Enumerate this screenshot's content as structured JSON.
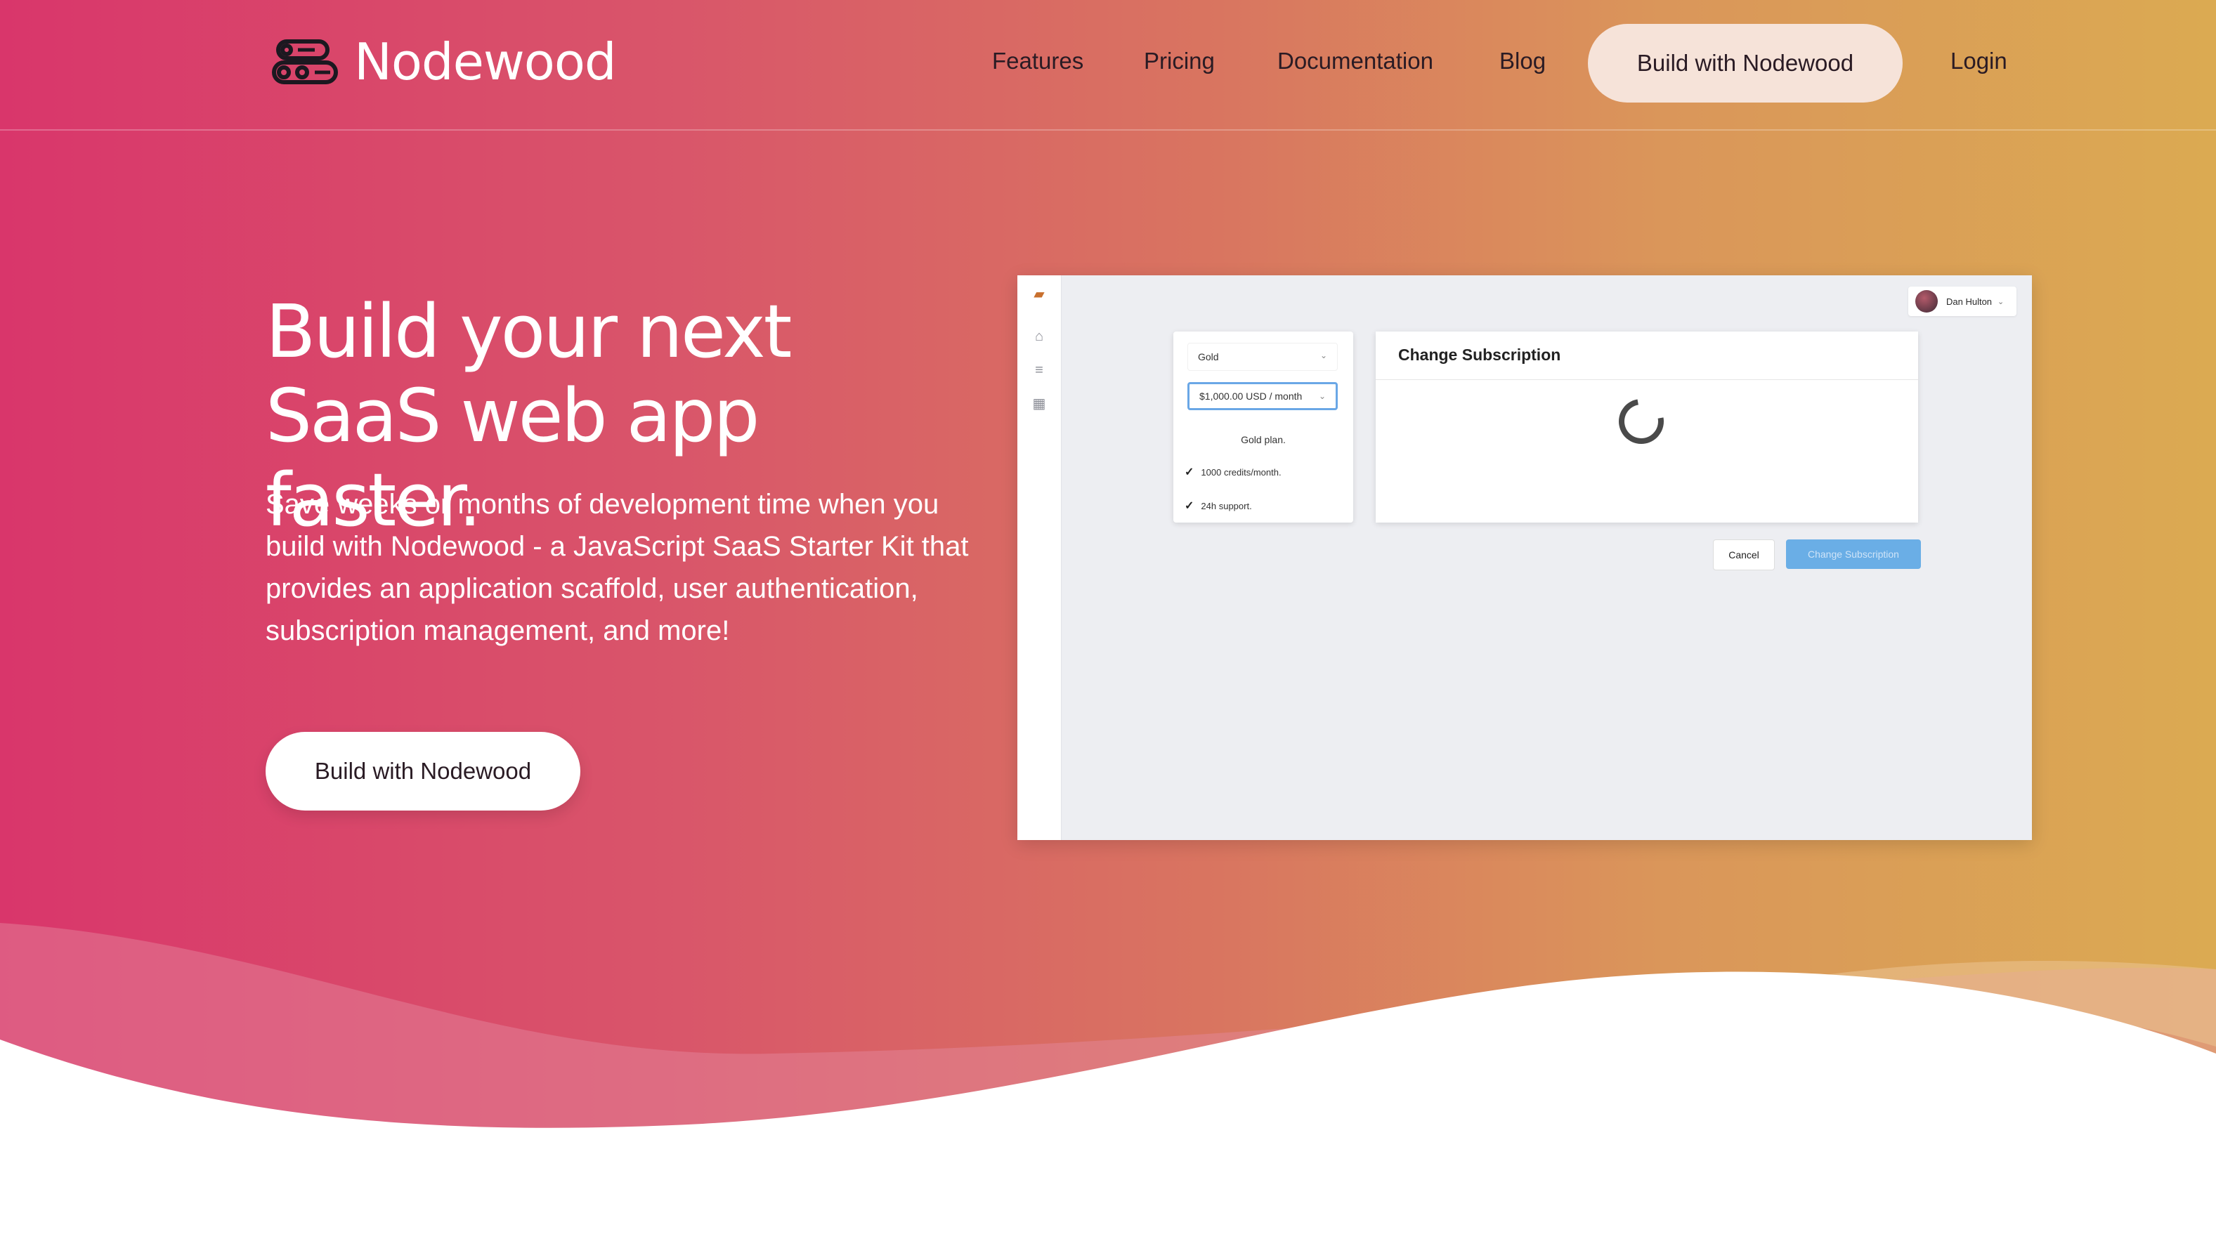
{
  "brand": {
    "name": "Nodewood"
  },
  "nav": {
    "links": [
      "Features",
      "Pricing",
      "Documentation",
      "Blog"
    ],
    "cta": "Build with Nodewood",
    "login": "Login"
  },
  "hero": {
    "headline": "Build your next SaaS web app faster.",
    "subtext": "Save weeks or months of development time when you build with Nodewood - a JavaScript SaaS Starter Kit that provides an application scaffold, user authentication, subscription management, and more!",
    "cta": "Build with Nodewood"
  },
  "preview": {
    "user": "Dan Hulton",
    "plan_select": "Gold",
    "price_select": "$1,000.00 USD / month",
    "plan_description": "Gold plan.",
    "features": [
      "1000 credits/month.",
      "24h support."
    ],
    "modal_title": "Change Subscription",
    "cancel": "Cancel",
    "confirm": "Change Subscription"
  },
  "colors": {
    "gradient_start": "#d9366b",
    "gradient_end": "#dbaa52",
    "cta_nav_bg": "#f6e3d9",
    "primary_button": "#6aaee6"
  }
}
